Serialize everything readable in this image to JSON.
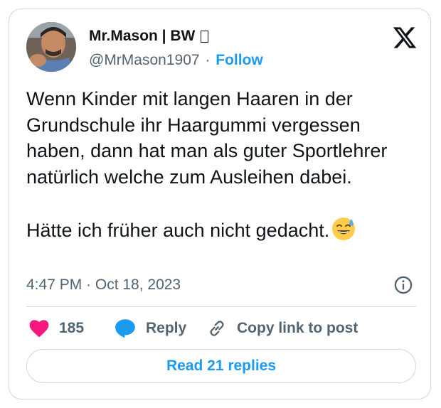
{
  "author": {
    "display_name": "Mr.Mason | BW",
    "handle": "@MrMason1907",
    "separator": "·",
    "follow_label": "Follow"
  },
  "tweet": {
    "paragraph_1": "Wenn Kinder mit langen Haaren in der Grundschule ihr Haargummi vergessen haben, dann hat man als guter Sportlehrer natürlich welche zum Ausleihen dabei.",
    "paragraph_2": "Hätte ich früher auch nicht gedacht.",
    "emoji": "sweat-smile-emoji",
    "timestamp": "4:47 PM · Oct 18, 2023"
  },
  "actions": {
    "like_count": "185",
    "reply_label": "Reply",
    "copy_link_label": "Copy link to post"
  },
  "footer": {
    "read_replies_label": "Read 21 replies"
  },
  "icons": {
    "brand": "x-logo-icon",
    "like": "heart-icon",
    "reply": "speech-bubble-icon",
    "copy": "link-icon",
    "info": "info-icon"
  },
  "colors": {
    "accent": "#1d9bf0",
    "like": "#f91880",
    "text": "#0f1419",
    "secondary": "#536471",
    "border": "#cfd9de"
  }
}
